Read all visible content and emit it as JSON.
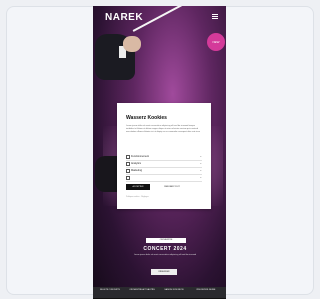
{
  "header": {
    "logo": "NAREK"
  },
  "cookie_dialog": {
    "title": "Wasserz Kookies",
    "body": "Lorem ipsum dolor sit amet consectetur adipiscing elit sed do eiusmod tempor incididunt ut labore et dolore magna aliqua ut enim ad minim veniam quis nostrud exercitation ullamco laboris nisi ut aliquip ex ea commodo consequat duis aute irure",
    "options": [
      {
        "label": "Functionnement"
      },
      {
        "label": "Analytics"
      },
      {
        "label": "Marketing"
      },
      {
        "label": ""
      }
    ],
    "accept_label": "ACCEPTER",
    "deny_label": "REFUSER TOUT",
    "links": "Politique cookies · Réglages"
  },
  "hero": {
    "chip": "ORCHESTRE",
    "title": "CONCERT 2024",
    "subtitle": "Lorem ipsum dolor sit amet consectetur adipiscing elit sed do eiusmod",
    "button": "RÉSERVER"
  },
  "badge": {
    "text": "NEW"
  },
  "bottom_nav": {
    "items": [
      {
        "label": "BILLETS CONCERTS"
      },
      {
        "label": "ORCHESTRE ACTUALITÉS"
      },
      {
        "label": "SAISON 2024 INFOS"
      },
      {
        "label": "ÉDUCATION JEUNE"
      }
    ]
  },
  "colors": {
    "accent": "#d43a9a",
    "dialog_bg": "#ffffff",
    "nav_bg": "#2a2a2e"
  }
}
